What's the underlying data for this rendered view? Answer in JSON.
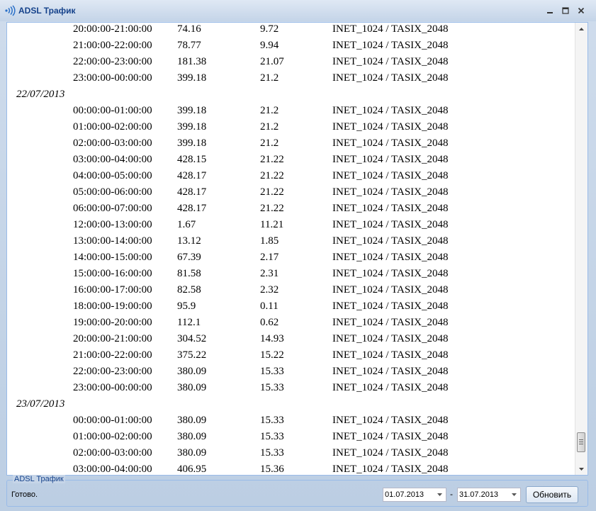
{
  "window": {
    "title": "ADSL Трафик"
  },
  "rows": [
    {
      "kind": "row",
      "time": "20:00:00-21:00:00",
      "v1": "74.16",
      "v2": "9.72",
      "plan": "INET_1024 / TASIX_2048"
    },
    {
      "kind": "row",
      "time": "21:00:00-22:00:00",
      "v1": "78.77",
      "v2": "9.94",
      "plan": "INET_1024 / TASIX_2048"
    },
    {
      "kind": "row",
      "time": "22:00:00-23:00:00",
      "v1": "181.38",
      "v2": "21.07",
      "plan": "INET_1024 / TASIX_2048"
    },
    {
      "kind": "row",
      "time": "23:00:00-00:00:00",
      "v1": "399.18",
      "v2": "21.2",
      "plan": "INET_1024 / TASIX_2048"
    },
    {
      "kind": "date",
      "label": "22/07/2013"
    },
    {
      "kind": "row",
      "time": "00:00:00-01:00:00",
      "v1": "399.18",
      "v2": "21.2",
      "plan": "INET_1024 / TASIX_2048"
    },
    {
      "kind": "row",
      "time": "01:00:00-02:00:00",
      "v1": "399.18",
      "v2": "21.2",
      "plan": "INET_1024 / TASIX_2048"
    },
    {
      "kind": "row",
      "time": "02:00:00-03:00:00",
      "v1": "399.18",
      "v2": "21.2",
      "plan": "INET_1024 / TASIX_2048"
    },
    {
      "kind": "row",
      "time": "03:00:00-04:00:00",
      "v1": "428.15",
      "v2": "21.22",
      "plan": "INET_1024 / TASIX_2048"
    },
    {
      "kind": "row",
      "time": "04:00:00-05:00:00",
      "v1": "428.17",
      "v2": "21.22",
      "plan": "INET_1024 / TASIX_2048"
    },
    {
      "kind": "row",
      "time": "05:00:00-06:00:00",
      "v1": "428.17",
      "v2": "21.22",
      "plan": "INET_1024 / TASIX_2048"
    },
    {
      "kind": "row",
      "time": "06:00:00-07:00:00",
      "v1": "428.17",
      "v2": "21.22",
      "plan": "INET_1024 / TASIX_2048"
    },
    {
      "kind": "row",
      "time": "12:00:00-13:00:00",
      "v1": "1.67",
      "v2": "11.21",
      "plan": "INET_1024 / TASIX_2048"
    },
    {
      "kind": "row",
      "time": "13:00:00-14:00:00",
      "v1": "13.12",
      "v2": "1.85",
      "plan": "INET_1024 / TASIX_2048"
    },
    {
      "kind": "row",
      "time": "14:00:00-15:00:00",
      "v1": "67.39",
      "v2": "2.17",
      "plan": "INET_1024 / TASIX_2048"
    },
    {
      "kind": "row",
      "time": "15:00:00-16:00:00",
      "v1": "81.58",
      "v2": "2.31",
      "plan": "INET_1024 / TASIX_2048"
    },
    {
      "kind": "row",
      "time": "16:00:00-17:00:00",
      "v1": "82.58",
      "v2": "2.32",
      "plan": "INET_1024 / TASIX_2048"
    },
    {
      "kind": "row",
      "time": "18:00:00-19:00:00",
      "v1": "95.9",
      "v2": "0.11",
      "plan": "INET_1024 / TASIX_2048"
    },
    {
      "kind": "row",
      "time": "19:00:00-20:00:00",
      "v1": "112.1",
      "v2": "0.62",
      "plan": "INET_1024 / TASIX_2048"
    },
    {
      "kind": "row",
      "time": "20:00:00-21:00:00",
      "v1": "304.52",
      "v2": "14.93",
      "plan": "INET_1024 / TASIX_2048"
    },
    {
      "kind": "row",
      "time": "21:00:00-22:00:00",
      "v1": "375.22",
      "v2": "15.22",
      "plan": "INET_1024 / TASIX_2048"
    },
    {
      "kind": "row",
      "time": "22:00:00-23:00:00",
      "v1": "380.09",
      "v2": "15.33",
      "plan": "INET_1024 / TASIX_2048"
    },
    {
      "kind": "row",
      "time": "23:00:00-00:00:00",
      "v1": "380.09",
      "v2": "15.33",
      "plan": "INET_1024 / TASIX_2048"
    },
    {
      "kind": "date",
      "label": "23/07/2013"
    },
    {
      "kind": "row",
      "time": "00:00:00-01:00:00",
      "v1": "380.09",
      "v2": "15.33",
      "plan": "INET_1024 / TASIX_2048"
    },
    {
      "kind": "row",
      "time": "01:00:00-02:00:00",
      "v1": "380.09",
      "v2": "15.33",
      "plan": "INET_1024 / TASIX_2048"
    },
    {
      "kind": "row",
      "time": "02:00:00-03:00:00",
      "v1": "380.09",
      "v2": "15.33",
      "plan": "INET_1024 / TASIX_2048"
    },
    {
      "kind": "row",
      "time": "03:00:00-04:00:00",
      "v1": "406.95",
      "v2": "15.36",
      "plan": "INET_1024 / TASIX_2048"
    }
  ],
  "footer": {
    "legend": "ADSL Трафик",
    "status": "Готово.",
    "date_from": "01.07.2013",
    "date_to": "31.07.2013",
    "dash": "-",
    "refresh_label": "Обновить"
  },
  "icons": {
    "app": "signal-waves-icon",
    "minimize": "minimize-icon",
    "maximize": "maximize-icon",
    "close": "close-icon",
    "dropdown": "chevron-down-icon"
  },
  "colors": {
    "title": "#15428b",
    "border": "#99bbe8",
    "icon": "#2a70c8"
  }
}
